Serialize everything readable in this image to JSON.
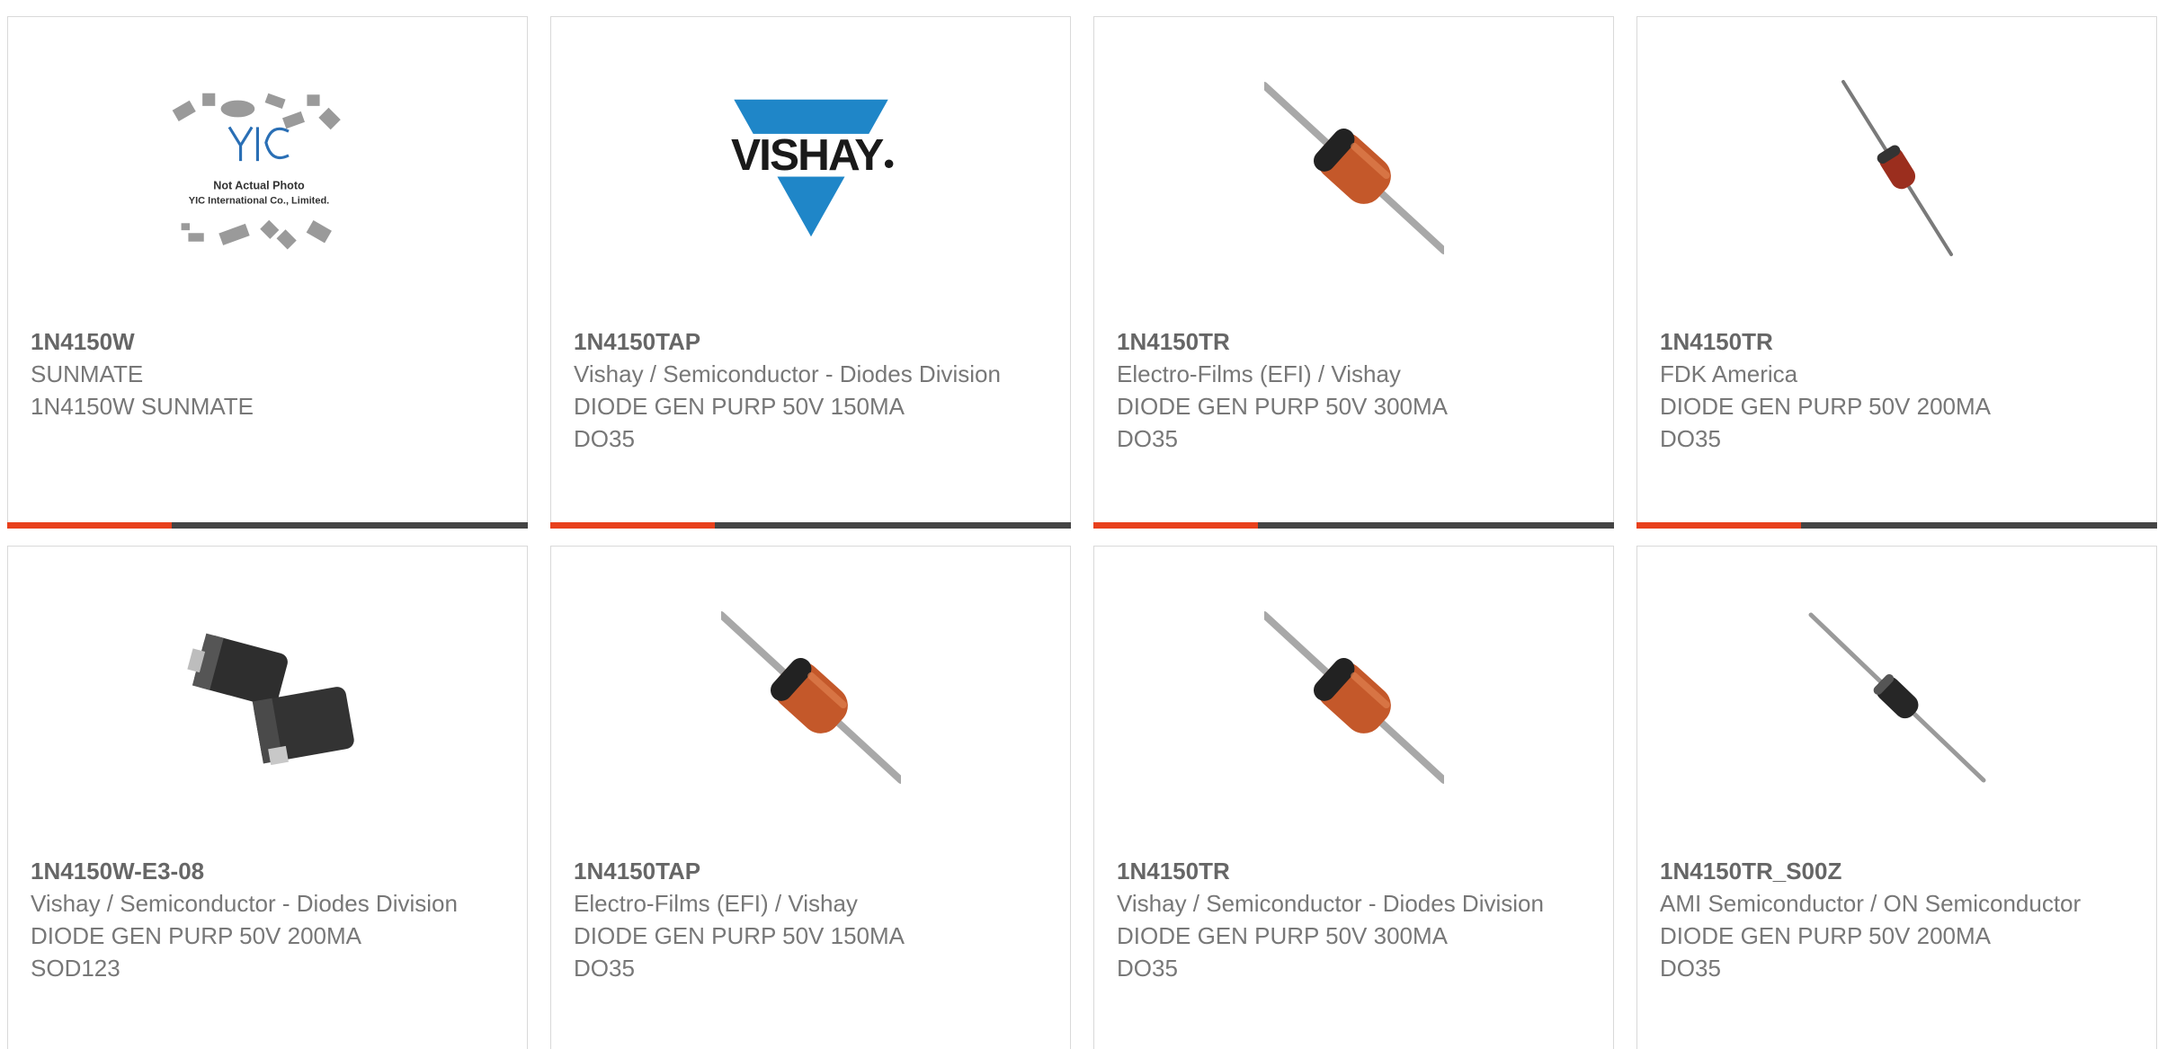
{
  "accent_color": "#e8401c",
  "bar_color": "#444444",
  "products": [
    {
      "part": "1N4150W",
      "maker": "SUNMATE",
      "desc": "1N4150W SUNMATE",
      "desc2": "",
      "image": "not-actual-photo-placeholder-icon",
      "image_text1": "Not Actual Photo",
      "image_text2": "YIC International Co., Limited."
    },
    {
      "part": "1N4150TAP",
      "maker": "Vishay / Semiconductor - Diodes Division",
      "desc": "DIODE GEN PURP 50V 150MA",
      "desc2": "DO35",
      "image": "vishay-logo-icon"
    },
    {
      "part": "1N4150TR",
      "maker": "Electro-Films (EFI) / Vishay",
      "desc": "DIODE GEN PURP 50V 300MA",
      "desc2": "DO35",
      "image": "orange-diode-icon"
    },
    {
      "part": "1N4150TR",
      "maker": "FDK America",
      "desc": "DIODE GEN PURP 50V 200MA",
      "desc2": "DO35",
      "image": "small-red-diode-icon"
    },
    {
      "part": "1N4150W-E3-08",
      "maker": "Vishay / Semiconductor - Diodes Division",
      "desc": "DIODE GEN PURP 50V 200MA",
      "desc2": "SOD123",
      "image": "smd-diode-icon"
    },
    {
      "part": "1N4150TAP",
      "maker": "Electro-Films (EFI) / Vishay",
      "desc": "DIODE GEN PURP 50V 150MA",
      "desc2": "DO35",
      "image": "orange-diode-icon"
    },
    {
      "part": "1N4150TR",
      "maker": "Vishay / Semiconductor - Diodes Division",
      "desc": "DIODE GEN PURP 50V 300MA",
      "desc2": "DO35",
      "image": "orange-diode-icon"
    },
    {
      "part": "1N4150TR_S00Z",
      "maker": "AMI Semiconductor / ON Semiconductor",
      "desc": "DIODE GEN PURP 50V 200MA",
      "desc2": "DO35",
      "image": "black-diode-icon"
    }
  ]
}
